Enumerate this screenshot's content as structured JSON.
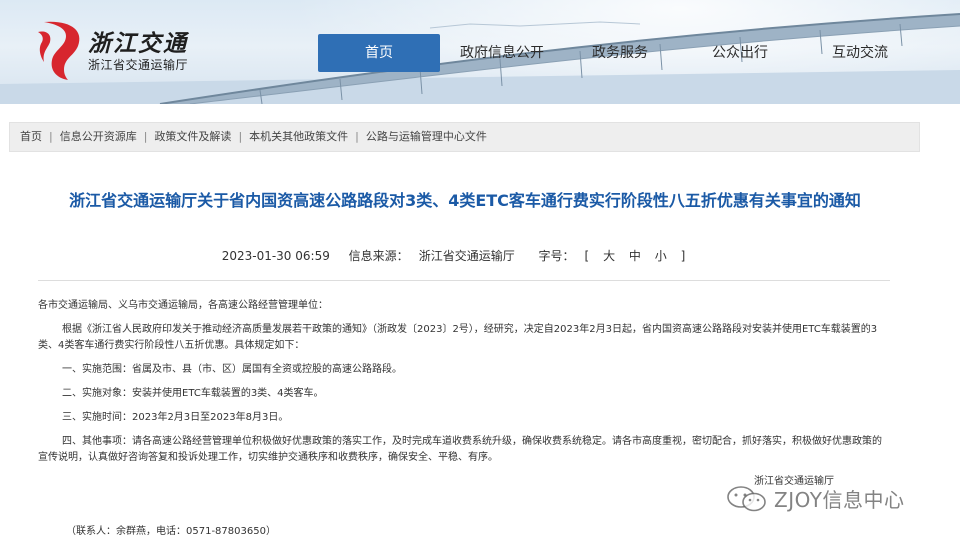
{
  "header": {
    "logo_title": "浙江交通",
    "logo_subtitle": "浙江省交通运输厅"
  },
  "nav": {
    "items": [
      {
        "label": "首页",
        "active": true
      },
      {
        "label": "政府信息公开",
        "active": false
      },
      {
        "label": "政务服务",
        "active": false
      },
      {
        "label": "公众出行",
        "active": false
      },
      {
        "label": "互动交流",
        "active": false
      }
    ]
  },
  "breadcrumb": [
    "首页",
    "信息公开资源库",
    "政策文件及解读",
    "本机关其他政策文件",
    "公路与运输管理中心文件"
  ],
  "breadcrumb_separator": "|",
  "article": {
    "title": "浙江省交通运输厅关于省内国资高速公路路段对3类、4类ETC客车通行费实行阶段性八五折优惠有关事宜的通知",
    "date": "2023-01-30 06:59",
    "source_label": "信息来源：",
    "source": "浙江省交通运输厅",
    "fontsize_label": "字号：",
    "fontsize_open": "[",
    "fontsize_large": "大",
    "fontsize_medium": "中",
    "fontsize_small": "小",
    "fontsize_close": "]",
    "paragraphs": [
      "各市交通运输局、义乌市交通运输局，各高速公路经营管理单位：",
      "根据《浙江省人民政府印发关于推动经济高质量发展若干政策的通知》（浙政发〔2023〕2号），经研究，决定自2023年2月3日起，省内国资高速公路路段对安装并使用ETC车载装置的3类、4类客车通行费实行阶段性八五折优惠。具体规定如下：",
      "一、实施范围：省属及市、县（市、区）属国有全资或控股的高速公路路段。",
      "二、实施对象：安装并使用ETC车载装置的3类、4类客车。",
      "三、实施时间：2023年2月3日至2023年8月3日。",
      "四、其他事项：请各高速公路经营管理单位积极做好优惠政策的落实工作，及时完成车道收费系统升级，确保收费系统稳定。请各市高度重视，密切配合，抓好落实，积极做好优惠政策的宣传说明，认真做好咨询答复和投诉处理工作，切实维护交通秩序和收费秩序，确保安全、平稳、有序。"
    ],
    "signature": "浙江省交通运输厅",
    "contact": "（联系人：余群燕，电话：0571-87803650）"
  },
  "watermark": {
    "text": "ZJOY信息中心"
  },
  "colors": {
    "nav_active_bg": "#2f6fb5",
    "title": "#1b5aa6",
    "logo_red": "#d7262e"
  }
}
